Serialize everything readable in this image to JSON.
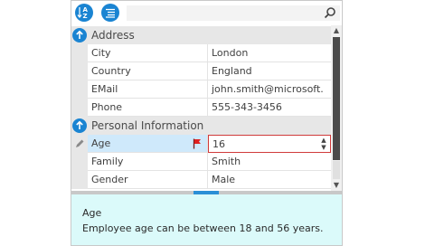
{
  "toolbar": {
    "sort_alpha_icon": "sort-alphabetical-icon",
    "categorize_icon": "categorize-icon",
    "search_placeholder": "",
    "search_icon": "search-icon"
  },
  "categories": [
    {
      "title": "Address",
      "rows": [
        {
          "name": "City",
          "value": "London"
        },
        {
          "name": "Country",
          "value": "England"
        },
        {
          "name": "EMail",
          "value": "john.smith@microsoft."
        },
        {
          "name": "Phone",
          "value": "555-343-3456"
        }
      ]
    },
    {
      "title": "Personal Information",
      "rows": [
        {
          "name": "Age",
          "value": "16"
        },
        {
          "name": "Family",
          "value": "Smith"
        },
        {
          "name": "Gender",
          "value": "Male"
        }
      ]
    }
  ],
  "description": {
    "title": "Age",
    "text": "Employee age can be between 18 and 56 years."
  },
  "colors": {
    "accent": "#1a84d2",
    "error_border": "#d03b3b",
    "selected_bg": "#cfe9fb",
    "description_bg": "#dbfafa",
    "flag": "#e02020"
  }
}
